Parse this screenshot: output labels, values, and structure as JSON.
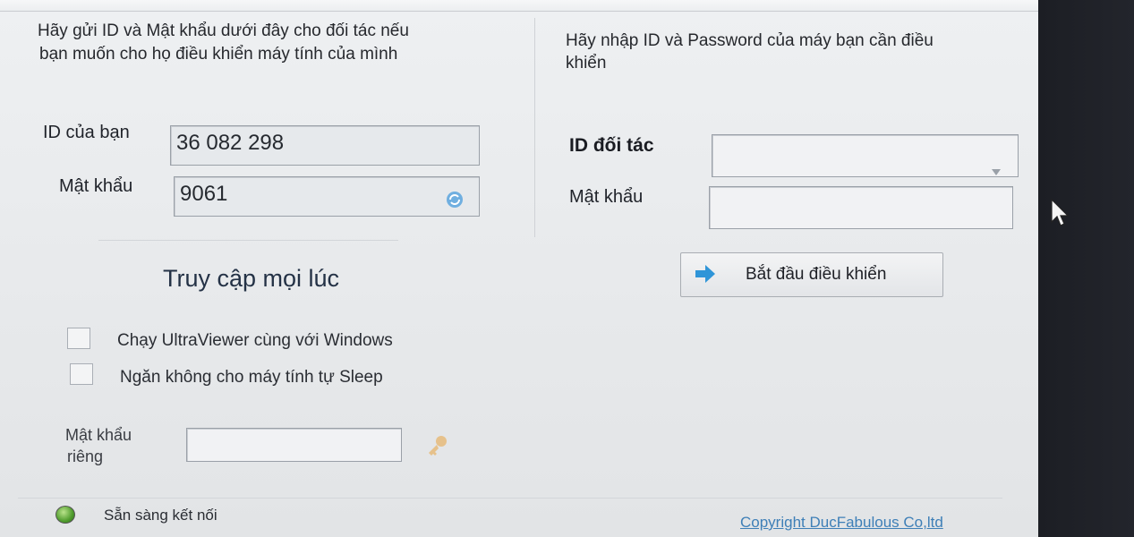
{
  "left_panel": {
    "instruction_line1": "Hãy gửi ID và Mật khẩu dưới đây cho đối tác nếu",
    "instruction_line2": "bạn muốn cho họ điều khiển máy tính của mình",
    "id_label": "ID của bạn",
    "id_value": "36 082 298",
    "password_label": "Mật khẩu",
    "password_value": "9061",
    "refresh_icon": "refresh-icon"
  },
  "right_panel": {
    "instruction_line1": "Hãy nhập ID và Password của máy bạn cần điều",
    "instruction_line2": "khiển",
    "partner_id_label": "ID đối tác",
    "partner_id_value": "",
    "partner_password_label": "Mật khẩu",
    "partner_password_value": "",
    "start_button_label": "Bắt đầu điều khiển",
    "start_button_icon": "arrow-right-icon"
  },
  "unattended": {
    "heading": "Truy cập mọi lúc",
    "option1": "Chạy UltraViewer cùng với Windows",
    "option2": "Ngăn không cho máy tính tự Sleep",
    "private_password_label_line1": "Mật khẩu",
    "private_password_label_line2": "riêng",
    "private_password_value": "",
    "key_icon": "key-icon"
  },
  "status": {
    "text": "Sẵn sàng kết nối",
    "indicator_color": "#4f9c2d",
    "copyright": "Copyright DucFabulous Co,ltd"
  },
  "colors": {
    "link": "#3e7fb7",
    "arrow": "#2f95d8"
  }
}
